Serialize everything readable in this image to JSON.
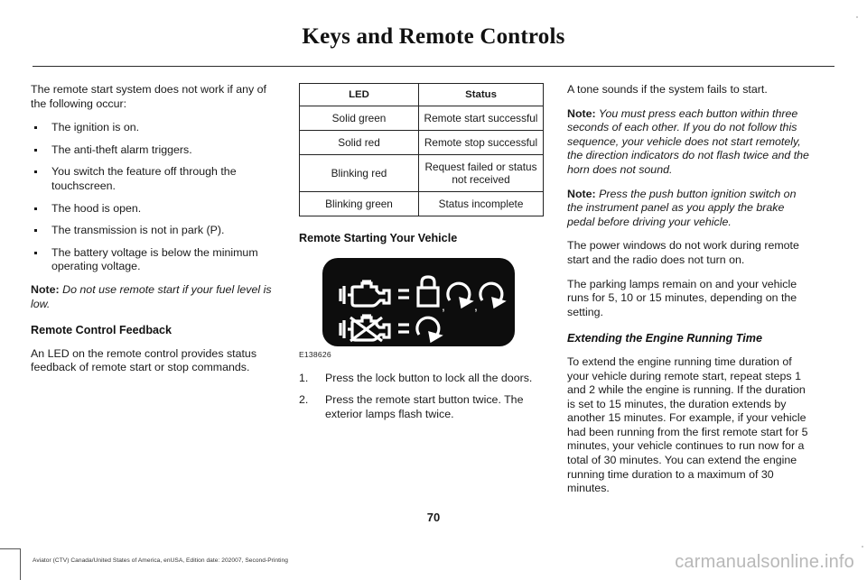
{
  "header": {
    "title": "Keys and Remote Controls"
  },
  "left_column": {
    "intro": "The remote start system does not work if any of the following occur:",
    "bullets": [
      "The ignition is on.",
      "The anti-theft alarm triggers.",
      "You switch the feature off through the touchscreen.",
      "The hood is open.",
      "The transmission is not in park (P).",
      "The battery voltage is below the minimum operating voltage."
    ],
    "note_label": "Note:",
    "note_text": "Do not use remote start if your fuel level is low.",
    "subhead": "Remote Control Feedback",
    "paragraph": "An LED on the remote control provides status feedback of remote start or stop commands."
  },
  "middle_column": {
    "table": {
      "headers": [
        "LED",
        "Status"
      ],
      "rows": [
        [
          "Solid green",
          "Remote start successful"
        ],
        [
          "Solid red",
          "Remote stop successful"
        ],
        [
          "Blinking red",
          "Request failed or status not received"
        ],
        [
          "Blinking green",
          "Status incomplete"
        ]
      ]
    },
    "subhead": "Remote Starting Your Vehicle",
    "figure": {
      "caption": "E138626",
      "icons": {
        "row1": [
          "engine-icon",
          "equals-sign",
          "padlock-icon",
          "comma",
          "rotate-clockwise-icon",
          "comma",
          "rotate-clockwise-icon"
        ],
        "row2": [
          "engine-off-icon",
          "equals-sign",
          "rotate-clockwise-icon"
        ]
      },
      "background_color": "#0d0d0d",
      "foreground_color": "#ffffff"
    },
    "steps": [
      "Press the lock button to lock all the doors.",
      "Press the remote start button twice.  The exterior lamps flash twice."
    ]
  },
  "right_column": {
    "paragraph1": "A tone sounds if the system fails to start.",
    "note1_label": "Note:",
    "note1_text": "  You must press each button within three seconds of each other.  If you do not follow this sequence, your vehicle does not start remotely, the direction indicators do not flash twice and the horn does not sound.",
    "note2_label": "Note:",
    "note2_text": " Press the push button ignition switch on the instrument panel as you apply the brake pedal before driving your vehicle.",
    "paragraph2": "The power windows do not work during remote start and the radio does not turn on.",
    "paragraph3": "The parking lamps remain on and your vehicle runs for 5, 10 or 15 minutes, depending on the setting.",
    "subhead": "Extending the Engine Running Time",
    "paragraph4": "To extend the engine running time duration of your vehicle during remote start, repeat steps 1 and 2 while the engine is running.  If the duration is set to 15 minutes, the duration extends by another 15 minutes.  For example, if your vehicle had been running from the first remote start for 5 minutes, your vehicle continues to run now for a total of 30 minutes.  You can extend the engine running time duration to a maximum of 30 minutes."
  },
  "footer": {
    "page_number": "70",
    "edition_note": "Aviator (CTV) Canada/United States of America, enUSA, Edition date: 202007, Second-Printing",
    "watermark": "carmanualsonline.info"
  }
}
